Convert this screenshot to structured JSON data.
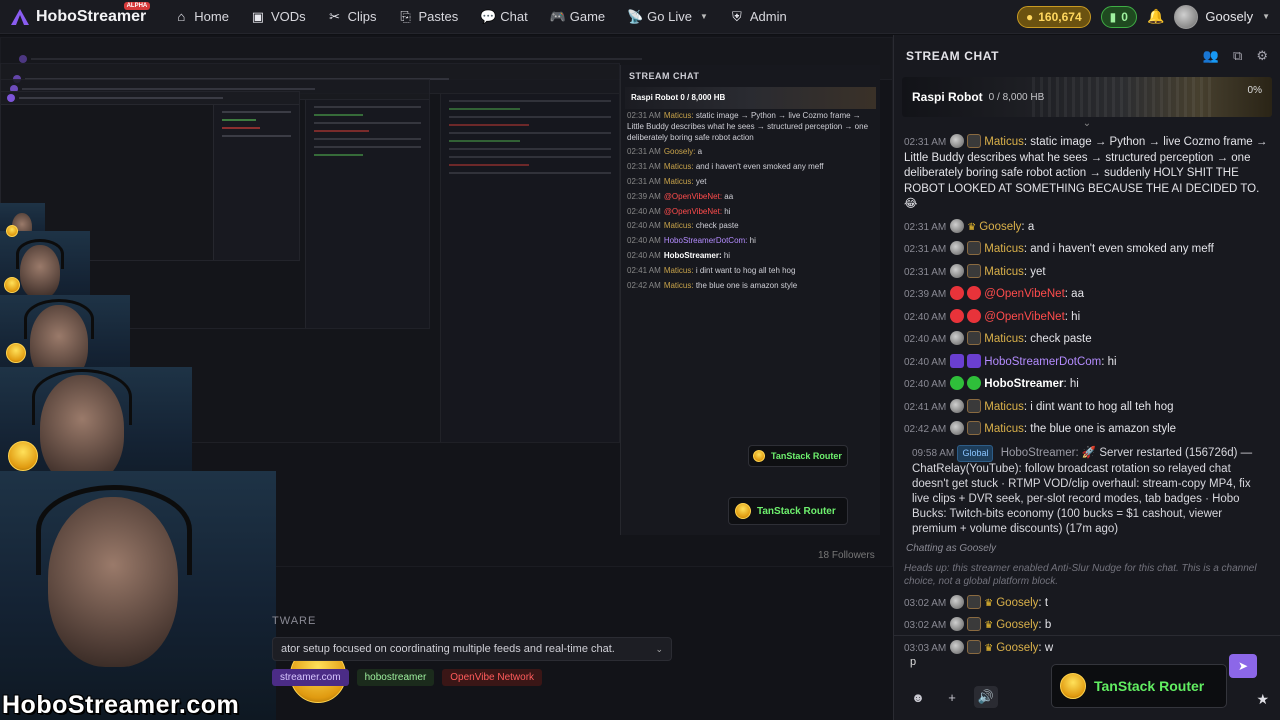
{
  "app": {
    "name": "HoboStreamer",
    "badge": "ALPHA",
    "watermark": "HoboStreamer.com"
  },
  "nav": [
    {
      "label": "Home",
      "icon": "home-icon"
    },
    {
      "label": "VODs",
      "icon": "film-icon"
    },
    {
      "label": "Clips",
      "icon": "scissors-icon"
    },
    {
      "label": "Pastes",
      "icon": "paste-icon"
    },
    {
      "label": "Chat",
      "icon": "chat-icon"
    },
    {
      "label": "Game",
      "icon": "gamepad-icon"
    },
    {
      "label": "Go Live",
      "icon": "broadcast-icon"
    },
    {
      "label": "Admin",
      "icon": "shield-icon"
    }
  ],
  "wallet": {
    "coins": "160,674",
    "green": "0"
  },
  "user": {
    "name": "Goosely"
  },
  "about": {
    "title_fragment": "TWARE",
    "desc_fragment": "ator setup focused on coordinating multiple feeds and real-time chat.",
    "links": [
      "streamer.com",
      "hobostreamer",
      "OpenVibe Network"
    ],
    "followers": "18 Followers"
  },
  "chat": {
    "title": "STREAM CHAT",
    "raspi": {
      "name": "Raspi Robot",
      "count": "0 / 8,000 HB",
      "pct": "0%"
    },
    "messages": [
      {
        "ts": "02:31 AM",
        "badges": [
          "gray",
          "shield"
        ],
        "name": "Maticus",
        "cls": "name-gold",
        "text": "static image → Python → live Cozmo frame → Little Buddy describes what he sees → structured perception → one deliberately boring safe robot action → suddenly HOLY SHIT THE ROBOT LOOKED AT SOMETHING BECAUSE THE AI DECIDED TO. 😂"
      },
      {
        "ts": "02:31 AM",
        "badges": [
          "gray",
          "crown"
        ],
        "name": "Goosely",
        "cls": "name-gold",
        "text": "a"
      },
      {
        "ts": "02:31 AM",
        "badges": [
          "gray",
          "shield"
        ],
        "name": "Maticus",
        "cls": "name-gold",
        "text": "and i haven't even smoked any meff"
      },
      {
        "ts": "02:31 AM",
        "badges": [
          "gray",
          "shield"
        ],
        "name": "Maticus",
        "cls": "name-gold",
        "text": "yet"
      },
      {
        "ts": "02:39 AM",
        "badges": [
          "red",
          "red"
        ],
        "name": "@OpenVibeNet",
        "cls": "name-red",
        "text": "aa"
      },
      {
        "ts": "02:40 AM",
        "badges": [
          "red",
          "red"
        ],
        "name": "@OpenVibeNet",
        "cls": "name-red",
        "text": "hi"
      },
      {
        "ts": "02:40 AM",
        "badges": [
          "gray",
          "shield"
        ],
        "name": "Maticus",
        "cls": "name-gold",
        "text": "check paste"
      },
      {
        "ts": "02:40 AM",
        "badges": [
          "purple",
          "purple"
        ],
        "name": "HoboStreamerDotCom",
        "cls": "name-purple",
        "text": "hi"
      },
      {
        "ts": "02:40 AM",
        "badges": [
          "green",
          "green"
        ],
        "name": "HoboStreamer",
        "cls": "name-white",
        "text": "hi"
      },
      {
        "ts": "02:41 AM",
        "badges": [
          "gray",
          "shield"
        ],
        "name": "Maticus",
        "cls": "name-gold",
        "text": "i dint want to hog all teh hog"
      },
      {
        "ts": "02:42 AM",
        "badges": [
          "gray",
          "shield"
        ],
        "name": "Maticus",
        "cls": "name-gold",
        "text": "the blue one is amazon style"
      }
    ],
    "system": {
      "ts": "09:58 AM",
      "tag": "Global",
      "name": "HoboStreamer:",
      "text": "🚀 Server restarted (156726d) — ChatRelay(YouTube): follow broadcast rotation so relayed chat doesn't get stuck · RTMP VOD/clip overhaul: stream-copy MP4, fix live clips + DVR seek, per-slot record modes, tab badges · Hobo Bucks: Twitch-bits economy (100 bucks = $1 cashout, viewer premium + volume discounts) (17m ago)"
    },
    "chatting_as": "Chatting as Goosely",
    "heads_up": "Heads up: this streamer enabled Anti-Slur Nudge for this chat. This is a channel choice, not a global platform block.",
    "late_messages": [
      {
        "ts": "03:02 AM",
        "name": "Goosely",
        "text": "t"
      },
      {
        "ts": "03:02 AM",
        "name": "Goosely",
        "text": "b"
      },
      {
        "ts": "03:03 AM",
        "name": "Goosely",
        "text": "w"
      }
    ],
    "input_value": "p",
    "router": "TanStack Router"
  }
}
